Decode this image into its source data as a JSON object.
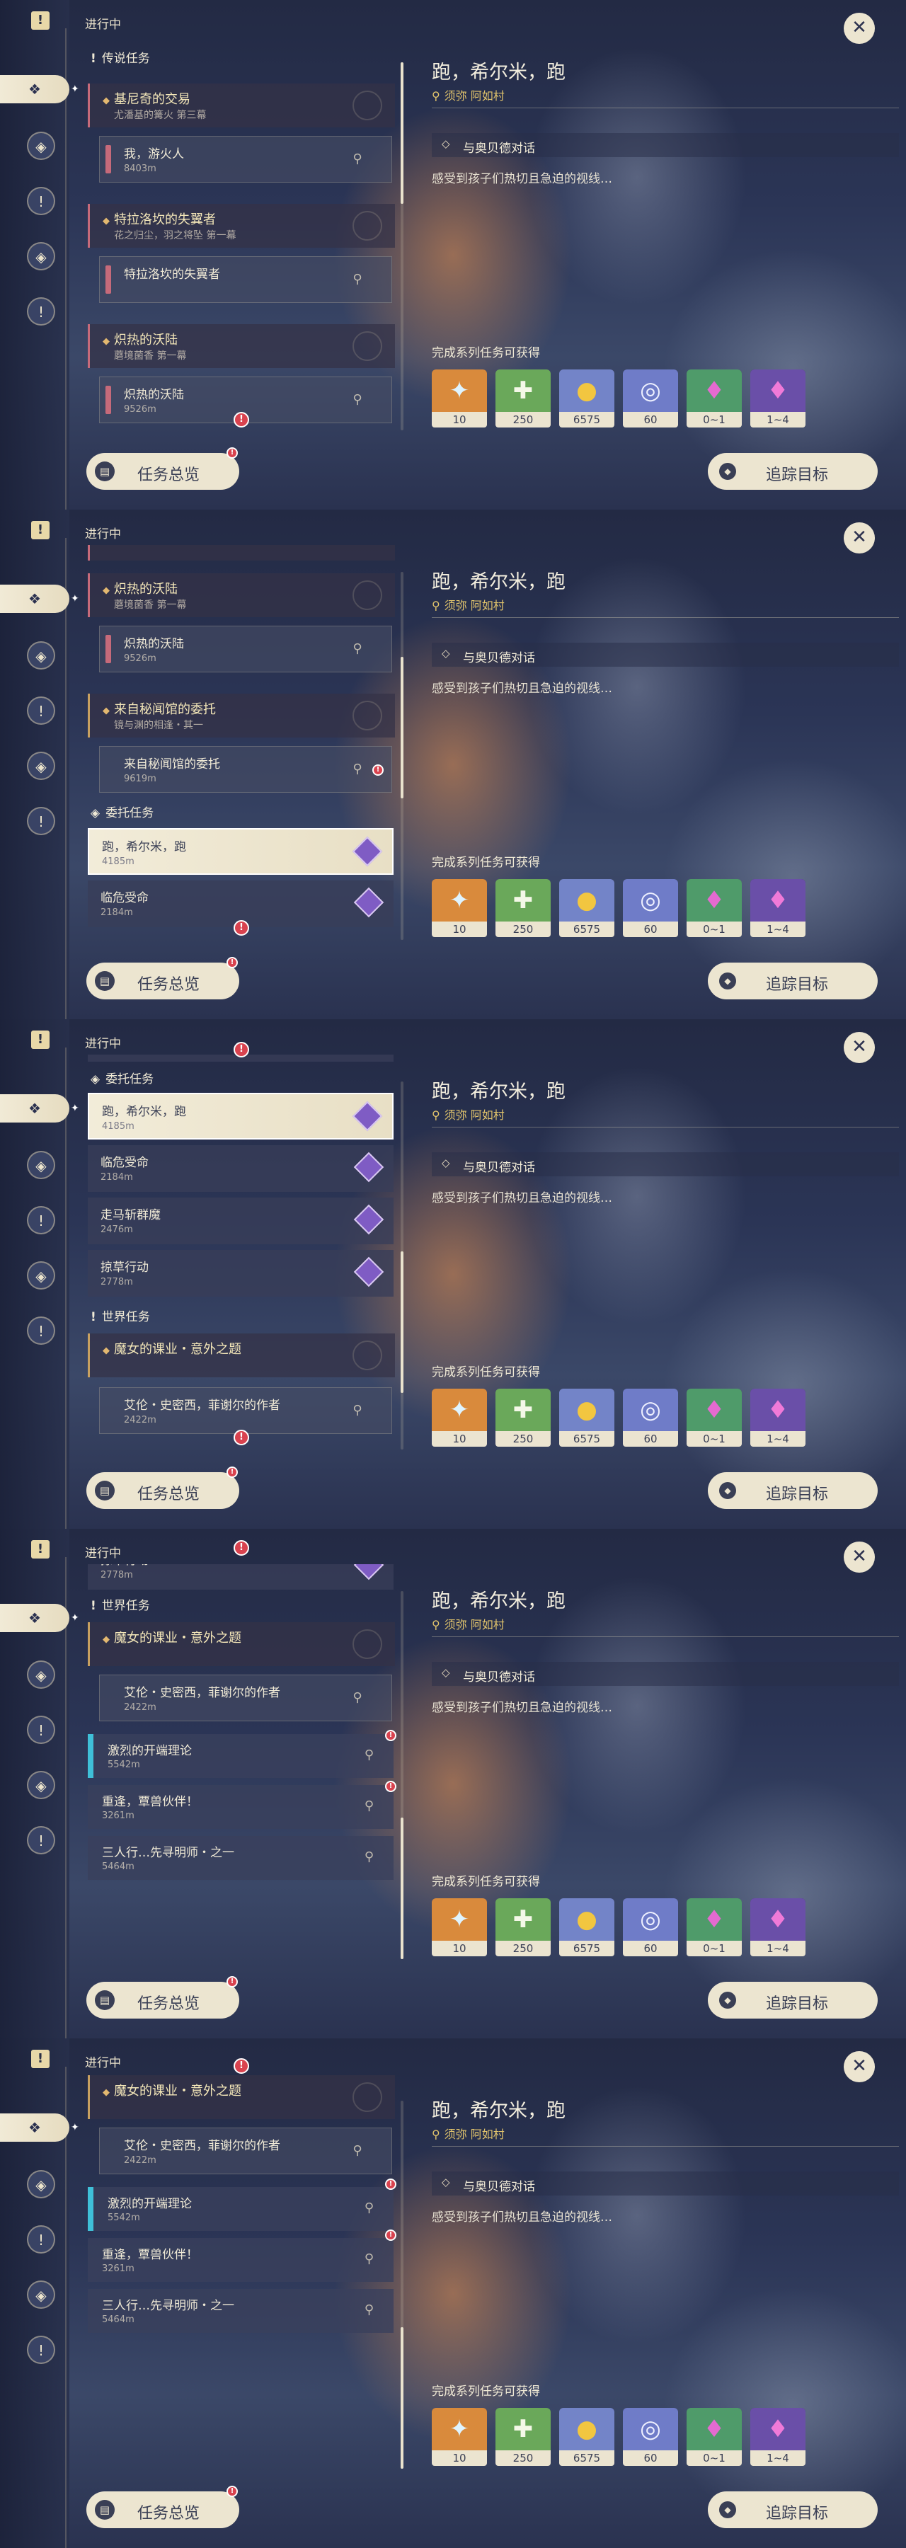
{
  "ui": {
    "in_progress": "进行中",
    "overview_label": "任务总览",
    "track_label": "追踪目标",
    "close_glyph": "✕"
  },
  "categories": {
    "legend": "传说任务",
    "commission": "委托任务",
    "world": "世界任务"
  },
  "legend_chains": [
    {
      "title": "基尼奇的交易",
      "sub": "尤潘基的篝火 第三幕",
      "quest": "我，游火人",
      "dist": "8403m"
    },
    {
      "title": "特拉洛坎的失翼者",
      "sub": "花之归尘，羽之将坠 第一幕",
      "quest": "特拉洛坎的失翼者",
      "dist": ""
    },
    {
      "title": "炽热的沃陆",
      "sub": "蘑境菌香 第一幕",
      "quest": "炽热的沃陆",
      "dist": "9526m"
    },
    {
      "title": "来自秘闻馆的委托",
      "sub": "镜与渊的相逢・其一",
      "quest": "来自秘闻馆的委托",
      "dist": "9619m"
    }
  ],
  "commissions": [
    {
      "name": "跑，希尔米，跑",
      "dist": "4185m"
    },
    {
      "name": "临危受命",
      "dist": "2184m"
    },
    {
      "name": "走马斩群魔",
      "dist": "2476m"
    },
    {
      "name": "掠草行动",
      "dist": "2778m"
    }
  ],
  "world_chain": {
    "title": "魔女的课业・意外之题",
    "quest": "艾伦・史密西，菲谢尔的作者",
    "dist": "2422m"
  },
  "world_quests": [
    {
      "name": "激烈的开端理论",
      "dist": "5542m"
    },
    {
      "name": "重逢，覃兽伙伴！",
      "dist": "3261m"
    },
    {
      "name": "三人行…先寻明师・之一",
      "dist": "5464m"
    }
  ],
  "detail": {
    "title": "跑，希尔米，跑",
    "location": "须弥 阿如村",
    "objective": "与奥贝德对话",
    "description": "感受到孩子们热切且急迫的视线…",
    "rewards_heading": "完成系列任务可获得",
    "rewards": [
      {
        "count": "10",
        "icon": "intertwined-fate-icon",
        "color": "#d98a3c"
      },
      {
        "count": "250",
        "icon": "adventure-exp-icon",
        "color": "#6aa85a"
      },
      {
        "count": "6575",
        "icon": "mora-icon",
        "color": "#7384c8"
      },
      {
        "count": "60",
        "icon": "companionship-exp-icon",
        "color": "#6f7cc8"
      },
      {
        "count": "0~1",
        "icon": "crystal-chunk-icon",
        "color": "#4f9b6a"
      },
      {
        "count": "1~4",
        "icon": "crystal-cluster-icon",
        "color": "#6a4fa8"
      }
    ]
  }
}
